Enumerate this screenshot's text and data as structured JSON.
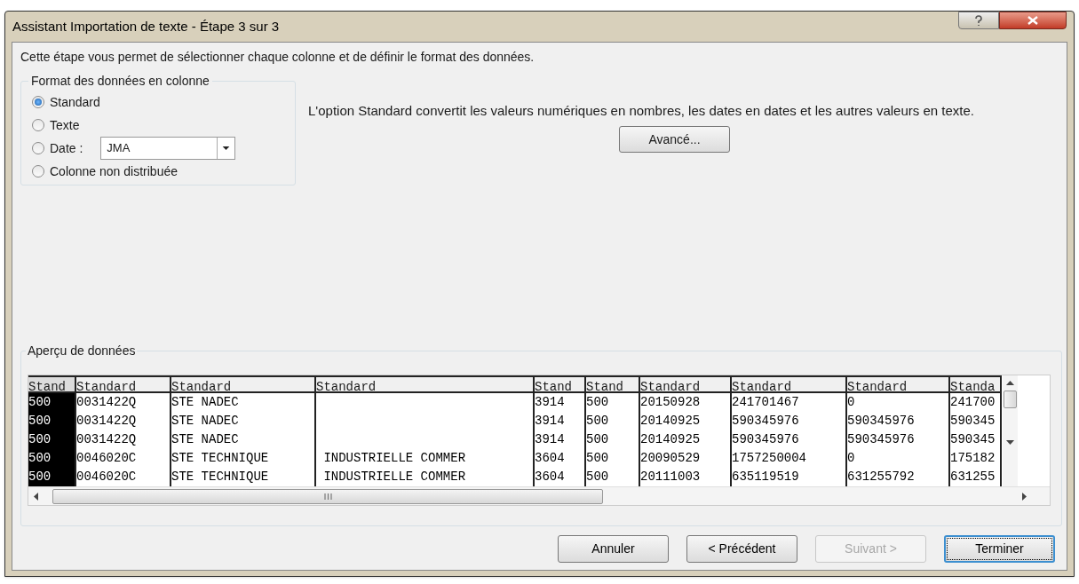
{
  "window": {
    "title": "Assistant Importation de texte - Étape 3 sur 3"
  },
  "instruction": "Cette étape vous permet de sélectionner chaque colonne et de définir le format des données.",
  "format_group": {
    "title": "Format des données en colonne",
    "options": [
      {
        "kind": "plain",
        "label": "Standard",
        "selected": true
      },
      {
        "kind": "plain",
        "label": "Texte",
        "selected": false
      },
      {
        "kind": "date",
        "label": "Date :",
        "selected": false,
        "dropdown_value": "JMA"
      },
      {
        "kind": "plain",
        "label": "Colonne non distribuée",
        "selected": false
      }
    ]
  },
  "description": "L'option Standard convertit les valeurs numériques en nombres, les dates en dates et les autres valeurs en texte.",
  "advanced_button": "Avancé...",
  "preview": {
    "title": "Aperçu de données",
    "columns": [
      {
        "header": "Stand",
        "selected": true
      },
      {
        "header": "Standard",
        "selected": false
      },
      {
        "header": "Standard",
        "selected": false
      },
      {
        "header": "Standard",
        "selected": false
      },
      {
        "header": "Stand",
        "selected": false
      },
      {
        "header": "Stand",
        "selected": false
      },
      {
        "header": "Standard",
        "selected": false
      },
      {
        "header": "Standard",
        "selected": false
      },
      {
        "header": "Standard",
        "selected": false
      },
      {
        "header": "Standa",
        "selected": false
      }
    ],
    "rows": [
      [
        "500",
        "0031422Q",
        "STE NADEC",
        "",
        "3914",
        "500",
        "20150928",
        "241701467",
        "0",
        "241700"
      ],
      [
        "500",
        "0031422Q",
        "STE NADEC",
        "",
        "3914",
        "500",
        "20140925",
        "590345976",
        "590345976",
        "590345"
      ],
      [
        "500",
        "0031422Q",
        "STE NADEC",
        "",
        "3914",
        "500",
        "20140925",
        "590345976",
        "590345976",
        "590345"
      ],
      [
        "500",
        "0046020C",
        "STE TECHNIQUE",
        " INDUSTRIELLE COMMER",
        "3604",
        "500",
        "20090529",
        "1757250004",
        "0",
        "175182"
      ],
      [
        "500",
        "0046020C",
        "STE TECHNIQUE",
        " INDUSTRIELLE COMMER",
        "3604",
        "500",
        "20111003",
        "635119519",
        "631255792",
        "631255"
      ]
    ]
  },
  "buttons": [
    {
      "label": "Annuler",
      "disabled": false,
      "default": false
    },
    {
      "label": "< Précédent",
      "disabled": false,
      "default": false
    },
    {
      "label": "Suivant >",
      "disabled": true,
      "default": false
    },
    {
      "label": "Terminer",
      "disabled": false,
      "default": true
    }
  ]
}
